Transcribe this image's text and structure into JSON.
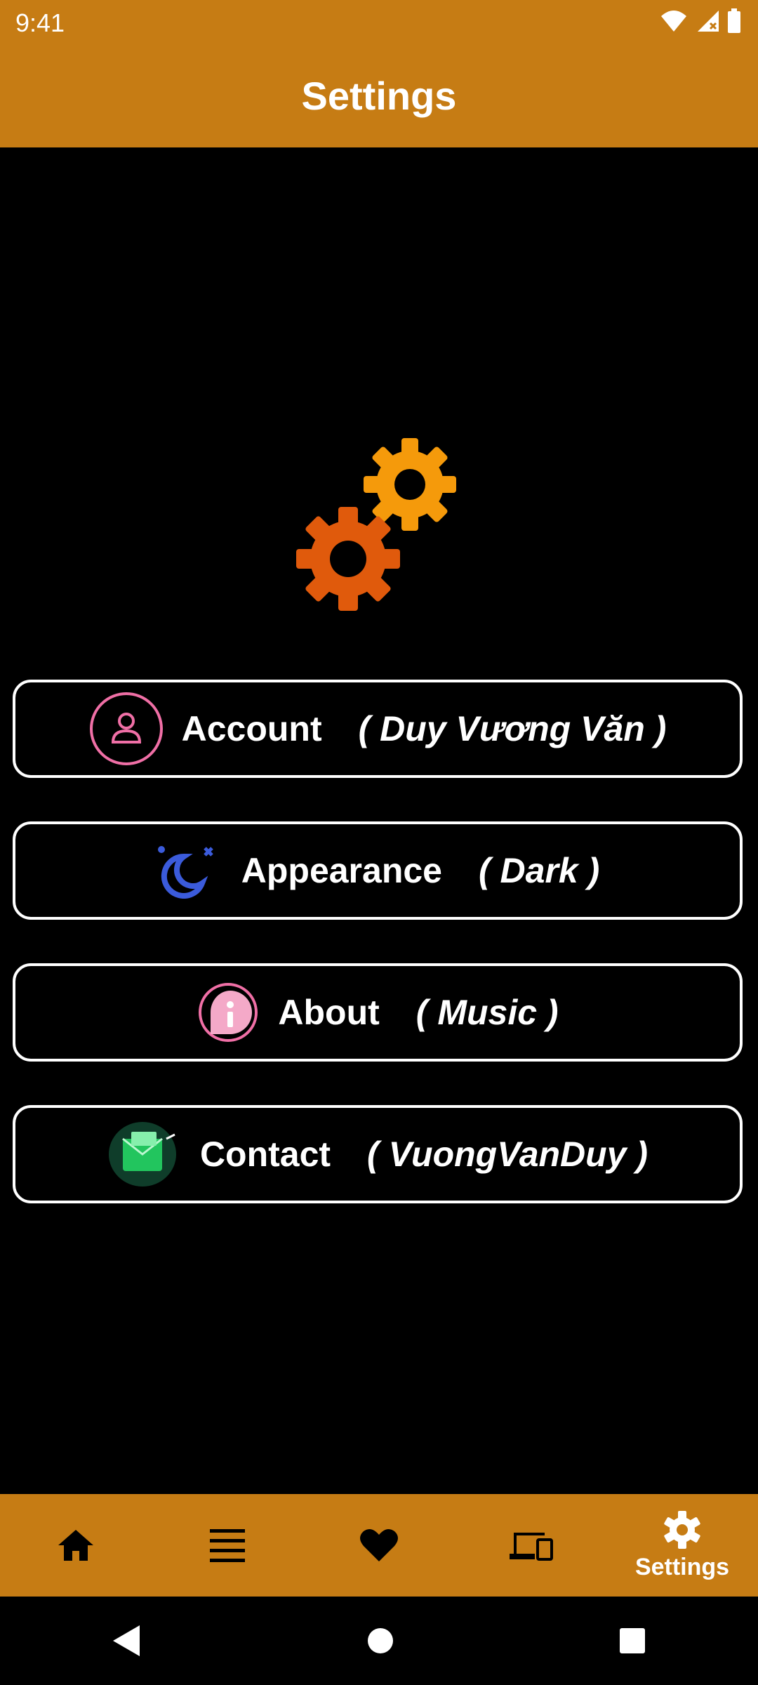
{
  "status_bar": {
    "time": "9:41",
    "icons": [
      "wifi-icon",
      "signal-icon",
      "battery-icon"
    ]
  },
  "app_bar": {
    "title": "Settings"
  },
  "hero": {
    "icon": "gears-icon"
  },
  "menu": [
    {
      "label": "Account",
      "sub": "( Duy Vương Văn )",
      "icon": "user-icon"
    },
    {
      "label": "Appearance",
      "sub": "( Dark )",
      "icon": "moon-icon"
    },
    {
      "label": "About",
      "sub": "( Music )",
      "icon": "info-icon"
    },
    {
      "label": "Contact",
      "sub": "( VuongVanDuy )",
      "icon": "mail-icon"
    }
  ],
  "bottom_nav": {
    "items": [
      {
        "icon": "home-icon"
      },
      {
        "icon": "list-icon"
      },
      {
        "icon": "heart-icon"
      },
      {
        "icon": "devices-icon"
      },
      {
        "icon": "gear-icon",
        "label": "Settings",
        "active": true
      }
    ]
  },
  "system_nav": {
    "icons": [
      "back-icon",
      "home-circle-icon",
      "recents-icon"
    ]
  },
  "colors": {
    "accent": "#C67C14",
    "background": "#000000",
    "text": "#FFFFFF",
    "gear_small": "#F59A0B",
    "gear_large": "#E05A0C"
  }
}
